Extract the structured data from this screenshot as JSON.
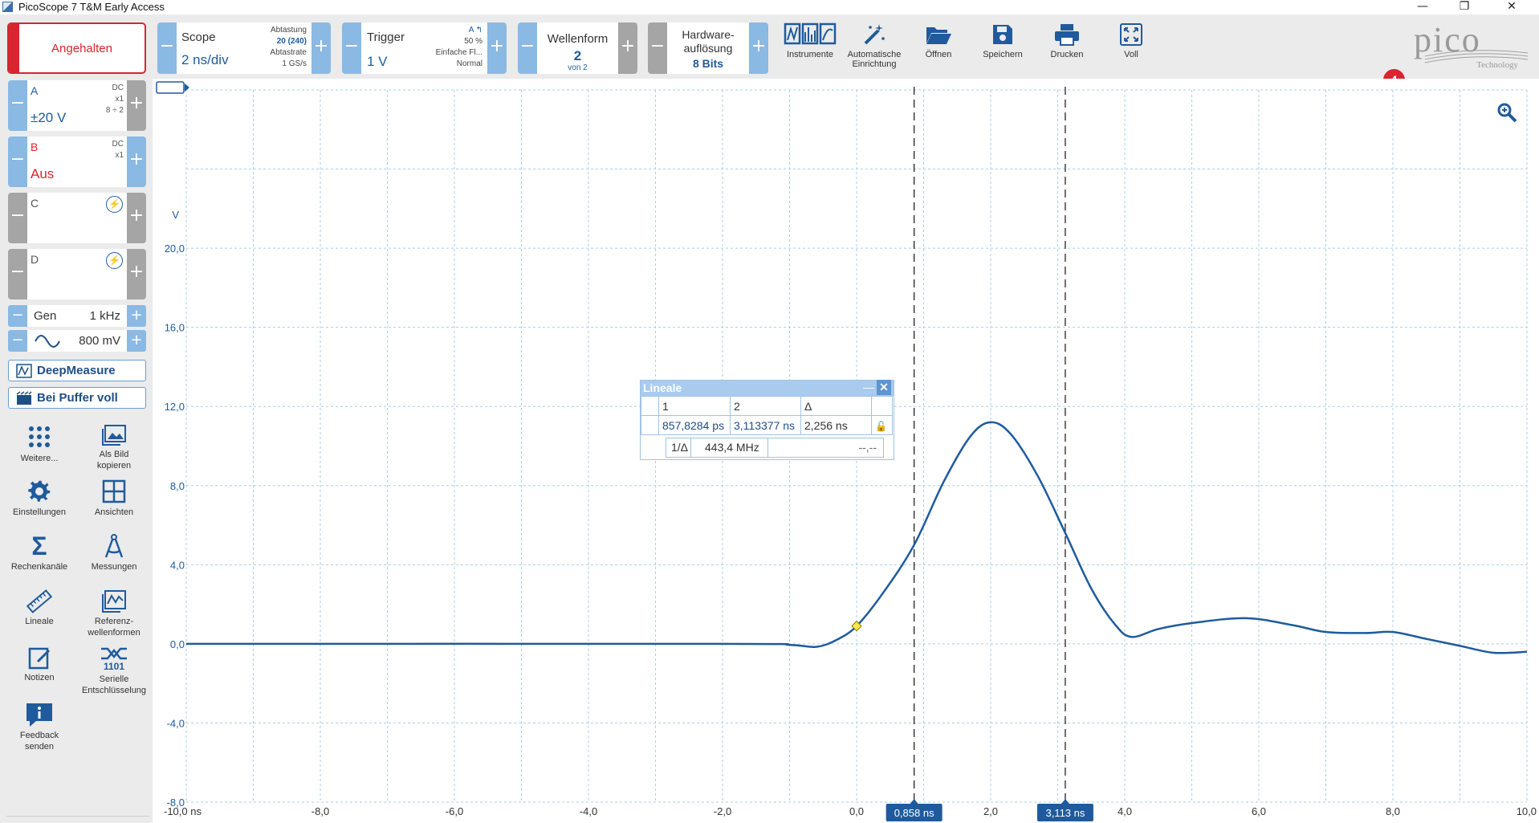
{
  "window": {
    "title": "PicoScope 7 T&M Early Access"
  },
  "toolbar": {
    "run_state": "Angehalten",
    "scope": {
      "name": "Scope",
      "value": "2 ns/div",
      "sampling_label": "Abtastung",
      "sampling_value": "20 (240)",
      "rate_label": "Abtastrate",
      "rate_value": "1 GS/s"
    },
    "trigger": {
      "name": "Trigger",
      "value": "1 V",
      "source": "A",
      "level": "50 %",
      "mode_short": "Einfache Fl...",
      "mode": "Normal"
    },
    "waveform": {
      "name": "Wellenform",
      "value": "2",
      "of": "von 2"
    },
    "hwres": {
      "name_line1": "Hardware-",
      "name_line2": "auflösung",
      "value": "8 Bits"
    },
    "tools": [
      {
        "icon": "instruments-icon",
        "label1": "Instrumente",
        "label2": ""
      },
      {
        "icon": "auto-setup-icon",
        "label1": "Automatische",
        "label2": "Einrichtung"
      },
      {
        "icon": "open-folder-icon",
        "label1": "Öffnen",
        "label2": ""
      },
      {
        "icon": "save-icon",
        "label1": "Speichern",
        "label2": ""
      },
      {
        "icon": "print-icon",
        "label1": "Drucken",
        "label2": ""
      },
      {
        "icon": "fullscreen-icon",
        "label1": "Voll",
        "label2": ""
      }
    ],
    "notification_count": "4",
    "logo_text": "pico",
    "logo_sub": "Technology"
  },
  "channels": [
    {
      "name": "A",
      "meta1": "DC",
      "meta2": "x1",
      "meta3": "8 ÷ 2",
      "range": "±20 V",
      "color": "#1f5b9c"
    },
    {
      "name": "B",
      "meta1": "DC",
      "meta2": "x1",
      "meta3": "",
      "range": "Aus",
      "color": "#d8252f"
    },
    {
      "name": "C",
      "meta1": "",
      "meta2": "",
      "meta3": "",
      "range": "",
      "color": "#555555"
    },
    {
      "name": "D",
      "meta1": "",
      "meta2": "",
      "meta3": "",
      "range": "",
      "color": "#555555"
    }
  ],
  "generator": {
    "label": "Gen",
    "freq": "1 kHz",
    "amplitude": "800 mV"
  },
  "sidebar": {
    "deepmeasure": "DeepMeasure",
    "buffer": "Bei Puffer voll",
    "tools": [
      {
        "icon": "more-icon",
        "label1": "Weitere...",
        "label2": ""
      },
      {
        "icon": "copy-image-icon",
        "label1": "Als Bild",
        "label2": "kopieren"
      },
      {
        "icon": "settings-icon",
        "label1": "Einstellungen",
        "label2": ""
      },
      {
        "icon": "views-icon",
        "label1": "Ansichten",
        "label2": ""
      },
      {
        "icon": "math-channels-icon",
        "label1": "Rechenkanäle",
        "label2": ""
      },
      {
        "icon": "measurements-icon",
        "label1": "Messungen",
        "label2": ""
      },
      {
        "icon": "rulers-icon",
        "label1": "Lineale",
        "label2": ""
      },
      {
        "icon": "reference-waveforms-icon",
        "label1": "Referenz-",
        "label2": "wellenformen"
      },
      {
        "icon": "notes-icon",
        "label1": "Notizen",
        "label2": ""
      },
      {
        "icon": "serial-decoding-icon",
        "label1": "Serielle",
        "label2": "Entschlüsselung"
      },
      {
        "icon": "feedback-icon",
        "label1": "Feedback",
        "label2": "senden"
      }
    ]
  },
  "rulers": {
    "title": "Lineale",
    "col1": "1",
    "col2": "2",
    "col3": "Δ",
    "val1": "857,8284 ps",
    "val2": "3,113377 ns",
    "delta": "2,256 ns",
    "inv_label": "1/Δ",
    "inv_value": "443,4 MHz",
    "extra": "--,--"
  },
  "chart_data": {
    "type": "line",
    "ylabel": "V",
    "y_ticks": [
      "20,0",
      "16,0",
      "12,0",
      "8,0",
      "4,0",
      "0,0",
      "-4,0",
      "-8,0"
    ],
    "x_ticks": [
      "-10,0 ns",
      "-8,0",
      "-6,0",
      "-4,0",
      "-2,0",
      "0,0",
      "2,0",
      "4,0",
      "6,0",
      "8,0",
      "10,0"
    ],
    "xlim": [
      -10,
      10
    ],
    "ylim": [
      -8,
      28
    ],
    "series": [
      {
        "color": "#1f5b9c",
        "x": [
          -10,
          -2.0,
          -1.0,
          -0.6,
          -0.3,
          0.0,
          0.4,
          0.858,
          1.3,
          1.7,
          2.0,
          2.3,
          2.7,
          3.113,
          3.5,
          3.85,
          4.1,
          4.5,
          5.0,
          5.8,
          6.5,
          7.0,
          7.6,
          8.0,
          8.5,
          9.0,
          9.5,
          10.0
        ],
        "y": [
          0.0,
          0.0,
          -0.05,
          -0.15,
          0.2,
          0.9,
          2.6,
          5.0,
          8.2,
          10.5,
          11.2,
          10.6,
          8.5,
          5.6,
          2.8,
          1.0,
          0.35,
          0.75,
          1.05,
          1.3,
          0.95,
          0.6,
          0.55,
          0.6,
          0.25,
          -0.1,
          -0.45,
          -0.4
        ]
      }
    ],
    "trigger_marker": {
      "x": 0.0,
      "y": 0.9
    },
    "cursors": [
      {
        "x": 0.858,
        "label": "0,858 ns"
      },
      {
        "x": 3.113,
        "label": "3,113 ns"
      }
    ]
  }
}
